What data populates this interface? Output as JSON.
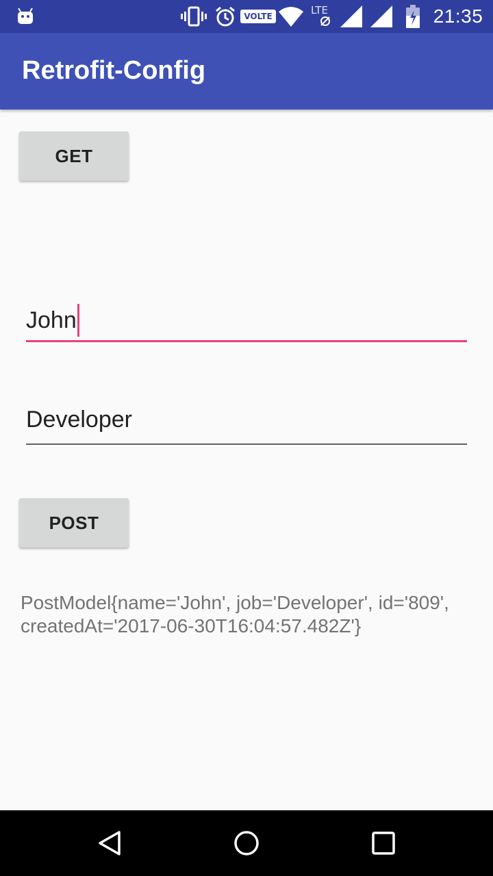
{
  "status_bar": {
    "time": "21:35",
    "volte_label": "VOLTE",
    "lte_label": "LTE",
    "icons": [
      "android-notification-icon",
      "vibrate-icon",
      "alarm-icon",
      "volte-icon",
      "wifi-icon",
      "lte-icon",
      "signal-icon",
      "signal-icon",
      "battery-icon"
    ]
  },
  "app_bar": {
    "title": "Retrofit-Config"
  },
  "main": {
    "get_button_label": "GET",
    "name_field": {
      "value": "John",
      "focused": true
    },
    "job_field": {
      "value": "Developer",
      "focused": false
    },
    "post_button_label": "POST",
    "result_text": "PostModel{name='John', job='Developer', id='809', createdAt='2017-06-30T16:04:57.482Z'}"
  },
  "nav_bar": {
    "icons": [
      "back-icon",
      "home-icon",
      "recents-icon"
    ]
  },
  "colors": {
    "status_bar": "#303f9f",
    "app_bar": "#3f51b5",
    "accent": "#ec407a",
    "background": "#fafafa",
    "button": "#d6d7d7"
  }
}
